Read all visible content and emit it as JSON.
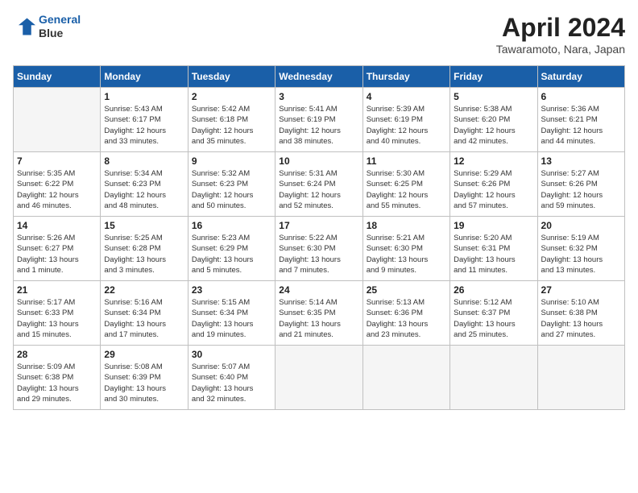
{
  "header": {
    "logo_line1": "General",
    "logo_line2": "Blue",
    "title": "April 2024",
    "location": "Tawaramoto, Nara, Japan"
  },
  "days_of_week": [
    "Sunday",
    "Monday",
    "Tuesday",
    "Wednesday",
    "Thursday",
    "Friday",
    "Saturday"
  ],
  "weeks": [
    [
      {
        "num": "",
        "info": ""
      },
      {
        "num": "1",
        "info": "Sunrise: 5:43 AM\nSunset: 6:17 PM\nDaylight: 12 hours\nand 33 minutes."
      },
      {
        "num": "2",
        "info": "Sunrise: 5:42 AM\nSunset: 6:18 PM\nDaylight: 12 hours\nand 35 minutes."
      },
      {
        "num": "3",
        "info": "Sunrise: 5:41 AM\nSunset: 6:19 PM\nDaylight: 12 hours\nand 38 minutes."
      },
      {
        "num": "4",
        "info": "Sunrise: 5:39 AM\nSunset: 6:19 PM\nDaylight: 12 hours\nand 40 minutes."
      },
      {
        "num": "5",
        "info": "Sunrise: 5:38 AM\nSunset: 6:20 PM\nDaylight: 12 hours\nand 42 minutes."
      },
      {
        "num": "6",
        "info": "Sunrise: 5:36 AM\nSunset: 6:21 PM\nDaylight: 12 hours\nand 44 minutes."
      }
    ],
    [
      {
        "num": "7",
        "info": "Sunrise: 5:35 AM\nSunset: 6:22 PM\nDaylight: 12 hours\nand 46 minutes."
      },
      {
        "num": "8",
        "info": "Sunrise: 5:34 AM\nSunset: 6:23 PM\nDaylight: 12 hours\nand 48 minutes."
      },
      {
        "num": "9",
        "info": "Sunrise: 5:32 AM\nSunset: 6:23 PM\nDaylight: 12 hours\nand 50 minutes."
      },
      {
        "num": "10",
        "info": "Sunrise: 5:31 AM\nSunset: 6:24 PM\nDaylight: 12 hours\nand 52 minutes."
      },
      {
        "num": "11",
        "info": "Sunrise: 5:30 AM\nSunset: 6:25 PM\nDaylight: 12 hours\nand 55 minutes."
      },
      {
        "num": "12",
        "info": "Sunrise: 5:29 AM\nSunset: 6:26 PM\nDaylight: 12 hours\nand 57 minutes."
      },
      {
        "num": "13",
        "info": "Sunrise: 5:27 AM\nSunset: 6:26 PM\nDaylight: 12 hours\nand 59 minutes."
      }
    ],
    [
      {
        "num": "14",
        "info": "Sunrise: 5:26 AM\nSunset: 6:27 PM\nDaylight: 13 hours\nand 1 minute."
      },
      {
        "num": "15",
        "info": "Sunrise: 5:25 AM\nSunset: 6:28 PM\nDaylight: 13 hours\nand 3 minutes."
      },
      {
        "num": "16",
        "info": "Sunrise: 5:23 AM\nSunset: 6:29 PM\nDaylight: 13 hours\nand 5 minutes."
      },
      {
        "num": "17",
        "info": "Sunrise: 5:22 AM\nSunset: 6:30 PM\nDaylight: 13 hours\nand 7 minutes."
      },
      {
        "num": "18",
        "info": "Sunrise: 5:21 AM\nSunset: 6:30 PM\nDaylight: 13 hours\nand 9 minutes."
      },
      {
        "num": "19",
        "info": "Sunrise: 5:20 AM\nSunset: 6:31 PM\nDaylight: 13 hours\nand 11 minutes."
      },
      {
        "num": "20",
        "info": "Sunrise: 5:19 AM\nSunset: 6:32 PM\nDaylight: 13 hours\nand 13 minutes."
      }
    ],
    [
      {
        "num": "21",
        "info": "Sunrise: 5:17 AM\nSunset: 6:33 PM\nDaylight: 13 hours\nand 15 minutes."
      },
      {
        "num": "22",
        "info": "Sunrise: 5:16 AM\nSunset: 6:34 PM\nDaylight: 13 hours\nand 17 minutes."
      },
      {
        "num": "23",
        "info": "Sunrise: 5:15 AM\nSunset: 6:34 PM\nDaylight: 13 hours\nand 19 minutes."
      },
      {
        "num": "24",
        "info": "Sunrise: 5:14 AM\nSunset: 6:35 PM\nDaylight: 13 hours\nand 21 minutes."
      },
      {
        "num": "25",
        "info": "Sunrise: 5:13 AM\nSunset: 6:36 PM\nDaylight: 13 hours\nand 23 minutes."
      },
      {
        "num": "26",
        "info": "Sunrise: 5:12 AM\nSunset: 6:37 PM\nDaylight: 13 hours\nand 25 minutes."
      },
      {
        "num": "27",
        "info": "Sunrise: 5:10 AM\nSunset: 6:38 PM\nDaylight: 13 hours\nand 27 minutes."
      }
    ],
    [
      {
        "num": "28",
        "info": "Sunrise: 5:09 AM\nSunset: 6:38 PM\nDaylight: 13 hours\nand 29 minutes."
      },
      {
        "num": "29",
        "info": "Sunrise: 5:08 AM\nSunset: 6:39 PM\nDaylight: 13 hours\nand 30 minutes."
      },
      {
        "num": "30",
        "info": "Sunrise: 5:07 AM\nSunset: 6:40 PM\nDaylight: 13 hours\nand 32 minutes."
      },
      {
        "num": "",
        "info": ""
      },
      {
        "num": "",
        "info": ""
      },
      {
        "num": "",
        "info": ""
      },
      {
        "num": "",
        "info": ""
      }
    ]
  ]
}
